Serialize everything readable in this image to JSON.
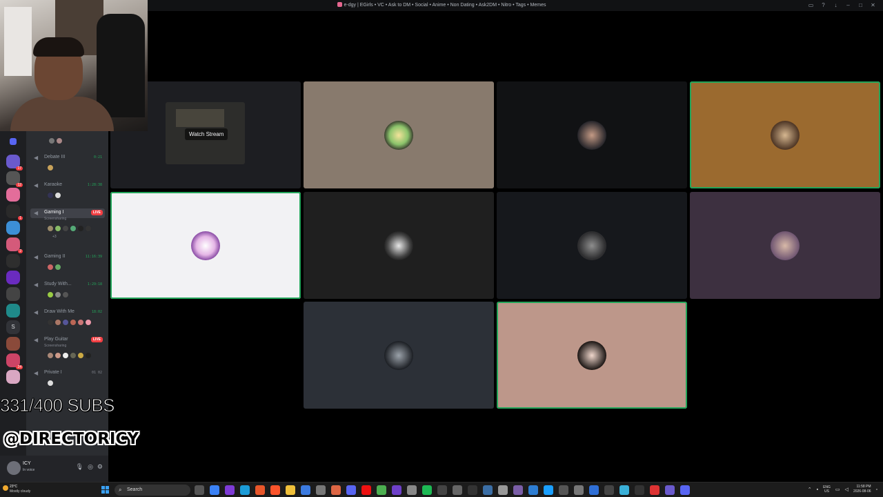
{
  "window": {
    "title": "e-dgy | EGirls • VC • Ask to DM • Social • Anime • Non Dating • Ask2DM • Nitro • Tags • Memes"
  },
  "stage": {
    "watch_stream_label": "Watch Stream"
  },
  "server_rail": {
    "letter_server": "S",
    "badges": [
      "17",
      "12",
      "1",
      "2",
      "24"
    ]
  },
  "voice_channels": [
    {
      "name": "Debate III",
      "timer": "0:21",
      "live": false,
      "members": 1,
      "color": "#c8a25a"
    },
    {
      "name": "Karaoke",
      "timer": "1:28:38",
      "live": false,
      "members": 2
    },
    {
      "name": "Gaming I",
      "live": true,
      "live_label": "LIVE",
      "sub": "Screensharing",
      "more": "+3",
      "members": 6
    },
    {
      "name": "Gaming II",
      "timer": "11:16:39",
      "live": false,
      "members": 2
    },
    {
      "name": "Study With...",
      "timer": "1:29:18",
      "live": false,
      "members": 3
    },
    {
      "name": "Draw With Me",
      "timer": "18:02",
      "live": false,
      "members": 6
    },
    {
      "name": "Play Guitar",
      "live": true,
      "live_label": "LIVE",
      "sub": "Screensharing",
      "members": 6
    },
    {
      "name": "Private I",
      "timer": "01  02",
      "live": false,
      "members": 1
    }
  ],
  "overlay": {
    "subs_text": "331/400 SUBS",
    "handle_text": "@DIRECTORICY"
  },
  "user_panel": {
    "username": "ICY",
    "status": "In voice"
  },
  "taskbar": {
    "weather_temp": "23°C",
    "weather_desc": "Mostly cloudy",
    "search_placeholder": "Search",
    "lang_top": "ENG",
    "lang_bottom": "US",
    "time": "11:58 PM",
    "date": "2026-08-06"
  },
  "colors": {
    "speaking_outline": "#23a55a",
    "live_badge": "#f23f43",
    "discord_bg": "#2b2d31"
  }
}
